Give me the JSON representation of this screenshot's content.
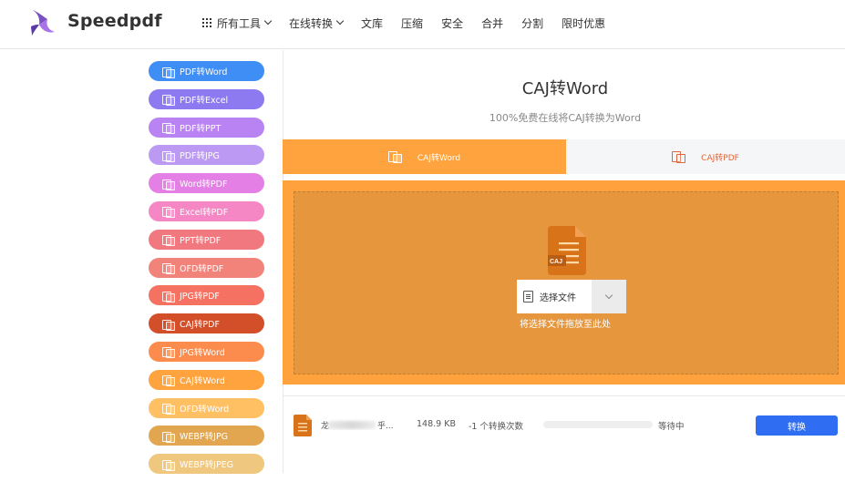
{
  "header": {
    "brand": "Speedpdf",
    "nav": [
      {
        "label": "所有工具",
        "has_grid_icon": true,
        "has_dropdown": true
      },
      {
        "label": "在线转换",
        "has_dropdown": true
      },
      {
        "label": "文库"
      },
      {
        "label": "压缩"
      },
      {
        "label": "安全"
      },
      {
        "label": "合并"
      },
      {
        "label": "分割"
      },
      {
        "label": "限时优惠"
      }
    ]
  },
  "sidebar": {
    "items": [
      {
        "label": "PDF转Word",
        "color": "#3f8ef5"
      },
      {
        "label": "PDF转Excel",
        "color": "#8e7af0"
      },
      {
        "label": "PDF转PPT",
        "color": "#b983f3"
      },
      {
        "label": "PDF转JPG",
        "color": "#bc9af3"
      },
      {
        "label": "Word转PDF",
        "color": "#e47fe6"
      },
      {
        "label": "Excel转PDF",
        "color": "#f587c4"
      },
      {
        "label": "PPT转PDF",
        "color": "#f2787f"
      },
      {
        "label": "OFD转PDF",
        "color": "#f2837a"
      },
      {
        "label": "JPG转PDF",
        "color": "#f57161"
      },
      {
        "label": "CAJ转PDF",
        "color": "#d34f2a"
      },
      {
        "label": "JPG转Word",
        "color": "#fc8c4e"
      },
      {
        "label": "CAJ转Word",
        "color": "#ffa33e"
      },
      {
        "label": "OFD转Word",
        "color": "#ffc064"
      },
      {
        "label": "WEBP转JPG",
        "color": "#e1a64f"
      },
      {
        "label": "WEBP转JPEG",
        "color": "#f0c77e"
      }
    ]
  },
  "main": {
    "title": "CAJ转Word",
    "subtitle": "100%免费在线将CAJ转换为Word",
    "tabs": [
      {
        "label": "CAJ转Word",
        "active": true
      },
      {
        "label": "CAJ转PDF",
        "active": false
      }
    ],
    "upload": {
      "file_icon_label": "CAJ",
      "select_label": "选择文件",
      "drop_hint": "将选择文件拖放至此处"
    },
    "file_row": {
      "name_prefix": "龙",
      "name_suffix": "乎...",
      "size": "148.9 KB",
      "count": "-1 个转换次数",
      "progress": 0,
      "status": "等待中",
      "convert_label": "转换"
    }
  },
  "colors": {
    "accent_orange": "#ffa33e",
    "drop_area": "#e6963d",
    "convert_blue": "#2f6ef2"
  }
}
